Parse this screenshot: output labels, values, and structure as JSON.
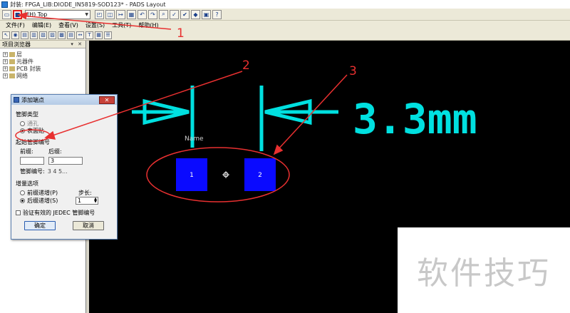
{
  "window": {
    "title": "封装: FPGA_LIB:DIODE_IN5819-SOD123* - PADS Layout"
  },
  "toolbar": {
    "layer_select": "(H) Top"
  },
  "menu": {
    "items": [
      "文件(F)",
      "编辑(E)",
      "查看(V)",
      "设置(S)",
      "工具(T)",
      "帮助(H)"
    ]
  },
  "project_browser": {
    "title": "项目浏览器",
    "controls": "▾ ✕",
    "items": [
      {
        "label": "层"
      },
      {
        "label": "元器件"
      },
      {
        "label": "PCB 封装"
      },
      {
        "label": "网络"
      }
    ]
  },
  "dialog": {
    "title": "添加端点",
    "close_label": "✕",
    "pin_type_label": "管脚类型",
    "option_through": "通孔",
    "option_smd": "表面贴",
    "start_pin_label": "起始管脚编号",
    "prefix_label": "前缀:",
    "suffix_label": "后缀:",
    "prefix_value": "",
    "suffix_value": "3",
    "pin_numbers_label": "管脚编号:",
    "pin_numbers_value": "3 4 5...",
    "increment_label": "增量选项",
    "option_prefix_inc": "前缀递增(P)",
    "option_suffix_inc": "后缀递增(S)",
    "step_label": "步长:",
    "step_value": "1",
    "jedec_label": "验证有效的 JEDEC 管脚编号",
    "ok_label": "确定",
    "cancel_label": "取消"
  },
  "canvas": {
    "dimension_text": "3.3mm",
    "name_label": "Name",
    "pad1_label": "1",
    "pad2_label": "2",
    "colors": {
      "dimension": "#00e0e0",
      "pad": "#0a0aff",
      "background": "#000000",
      "annotation": "#e83030"
    }
  },
  "annotations": {
    "callout_1": "1",
    "callout_2": "2",
    "callout_3": "3"
  },
  "watermark": {
    "text": "软件技巧"
  }
}
